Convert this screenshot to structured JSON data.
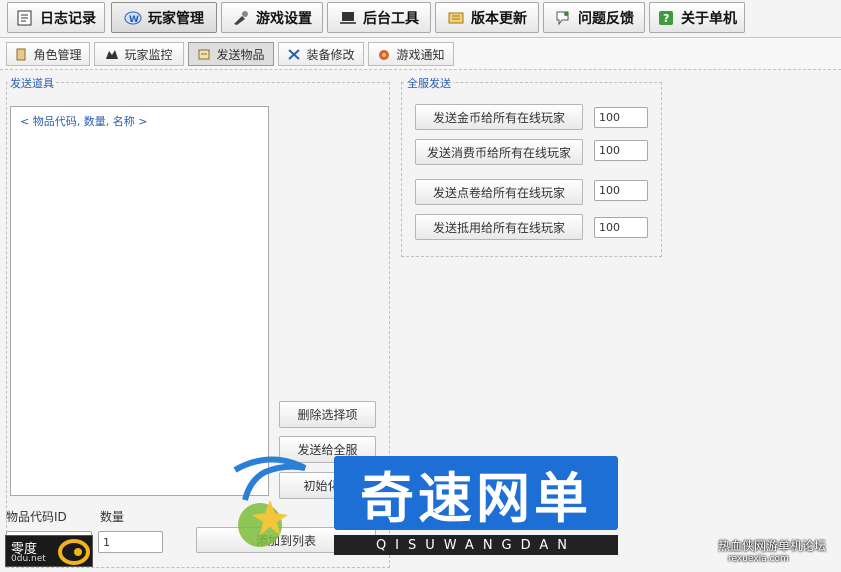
{
  "top_tabs": [
    {
      "label": "日志记录",
      "icon": "log-book-icon"
    },
    {
      "label": "玩家管理",
      "icon": "player-manage-icon"
    },
    {
      "label": "游戏设置",
      "icon": "game-settings-icon"
    },
    {
      "label": "后台工具",
      "icon": "laptop-icon"
    },
    {
      "label": "版本更新",
      "icon": "scroll-icon"
    },
    {
      "label": "问题反馈",
      "icon": "feedback-icon"
    },
    {
      "label": "关于单机",
      "icon": "help-icon"
    }
  ],
  "sub_tabs": [
    {
      "label": "角色管理",
      "icon": "character-icon"
    },
    {
      "label": "玩家监控",
      "icon": "monitor-icon"
    },
    {
      "label": "发送物品",
      "icon": "send-item-icon"
    },
    {
      "label": "装备修改",
      "icon": "equipment-icon"
    },
    {
      "label": "游戏通知",
      "icon": "notice-icon"
    }
  ],
  "send_items": {
    "group_title": "发送道具",
    "list_header": "< 物品代码, 数量, 名称 >",
    "delete_label": "删除选择项",
    "send_all_label": "发送给全服",
    "init_label": "初始化列",
    "add_label": "添加到列表",
    "item_code_label": "物品代码ID",
    "quantity_label": "数量",
    "item_code_value": "",
    "quantity_value": "1"
  },
  "server_send": {
    "group_title": "全服发送",
    "rows": [
      {
        "label": "发送金币给所有在线玩家",
        "value": "100"
      },
      {
        "label": "发送消费币给所有在线玩家",
        "value": "100"
      },
      {
        "label": "发送点卷给所有在线玩家",
        "value": "100"
      },
      {
        "label": "发送抵用给所有在线玩家",
        "value": "100"
      }
    ]
  },
  "watermarks": {
    "brand_cn": "奇速网单",
    "brand_en": "QISUWANGDAN",
    "forum": "热血侠网游单机论坛",
    "forum_url": "rexuexia.com",
    "corner_logo": "零度",
    "corner_url": "0du.net"
  },
  "colors": {
    "accent_blue": "#2a5db0",
    "brand_blue": "#1d6fd6"
  }
}
